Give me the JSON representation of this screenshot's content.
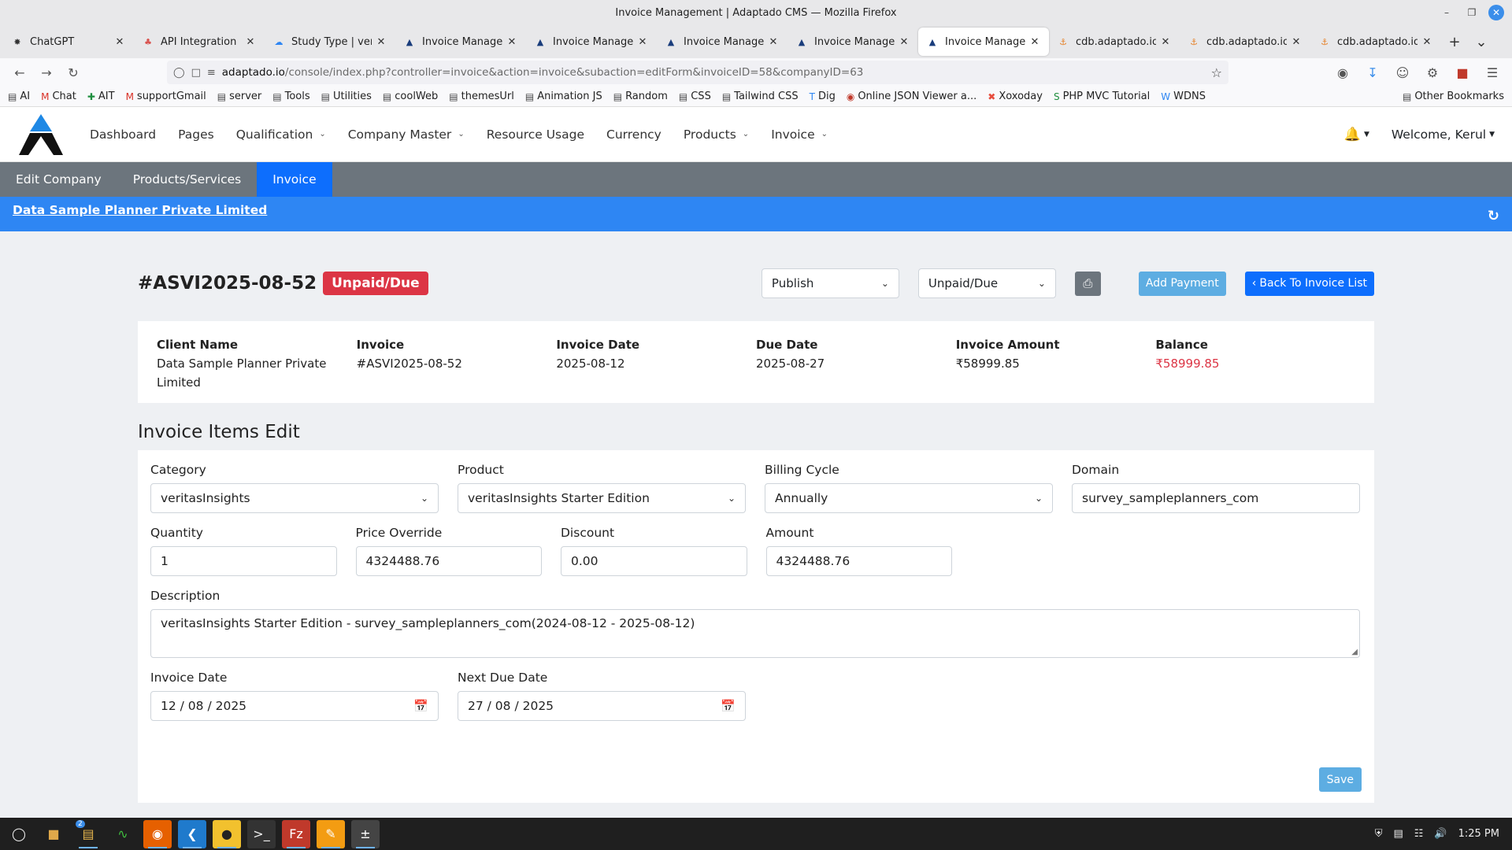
{
  "window": {
    "title": "Invoice Management | Adaptado CMS — Mozilla Firefox"
  },
  "tabs": [
    {
      "title": "ChatGPT",
      "icon": "chatgpt-icon",
      "active": false
    },
    {
      "title": "API Integration | ve",
      "icon": "api-icon",
      "active": false
    },
    {
      "title": "Study Type | verita",
      "icon": "cloud-icon",
      "active": false
    },
    {
      "title": "Invoice Manageme",
      "icon": "adaptado-icon",
      "active": false
    },
    {
      "title": "Invoice Manageme",
      "icon": "adaptado-icon",
      "active": false
    },
    {
      "title": "Invoice Manageme",
      "icon": "adaptado-icon",
      "active": false
    },
    {
      "title": "Invoice Manageme",
      "icon": "adaptado-icon",
      "active": false
    },
    {
      "title": "Invoice Manageme",
      "icon": "adaptado-icon",
      "active": true
    },
    {
      "title": "cdb.adaptado.io / ’",
      "icon": "phpmyadmin-icon",
      "active": false
    },
    {
      "title": "cdb.adaptado.io / ’",
      "icon": "phpmyadmin-icon",
      "active": false
    },
    {
      "title": "cdb.adaptado.io / ’",
      "icon": "phpmyadmin-icon",
      "active": false
    }
  ],
  "url": {
    "host": "adaptado.io",
    "rest": "/console/index.php?controller=invoice&action=invoice&subaction=editForm&invoiceID=58&companyID=63"
  },
  "bookmarks": [
    {
      "label": "AI",
      "icon": "folder-icon"
    },
    {
      "label": "Chat",
      "icon": "gmail-icon"
    },
    {
      "label": "AIT",
      "icon": "plus-icon"
    },
    {
      "label": "supportGmail",
      "icon": "gmail-icon"
    },
    {
      "label": "server",
      "icon": "folder-icon"
    },
    {
      "label": "Tools",
      "icon": "folder-icon"
    },
    {
      "label": "Utilities",
      "icon": "folder-icon"
    },
    {
      "label": "coolWeb",
      "icon": "folder-icon"
    },
    {
      "label": "themesUrl",
      "icon": "folder-icon"
    },
    {
      "label": "Animation JS",
      "icon": "folder-icon"
    },
    {
      "label": "Random",
      "icon": "folder-icon"
    },
    {
      "label": "CSS",
      "icon": "folder-icon"
    },
    {
      "label": "Tailwind CSS",
      "icon": "folder-icon"
    },
    {
      "label": "Dig",
      "icon": "t-icon"
    },
    {
      "label": "Online JSON Viewer a...",
      "icon": "circle-icon"
    },
    {
      "label": "Xoxoday",
      "icon": "x-icon"
    },
    {
      "label": "PHP MVC Tutorial",
      "icon": "s-icon"
    },
    {
      "label": "WDNS",
      "icon": "w-icon"
    }
  ],
  "bookmarks_other": "Other Bookmarks",
  "nav": {
    "items": [
      {
        "label": "Dashboard",
        "dropdown": false
      },
      {
        "label": "Pages",
        "dropdown": false
      },
      {
        "label": "Qualification",
        "dropdown": true
      },
      {
        "label": "Company Master",
        "dropdown": true
      },
      {
        "label": "Resource Usage",
        "dropdown": false
      },
      {
        "label": "Currency",
        "dropdown": false
      },
      {
        "label": "Products",
        "dropdown": true
      },
      {
        "label": "Invoice",
        "dropdown": true
      }
    ],
    "welcome": "Welcome, Kerul"
  },
  "subnav": [
    {
      "label": "Edit Company",
      "active": false
    },
    {
      "label": "Products/Services",
      "active": false
    },
    {
      "label": "Invoice",
      "active": true
    }
  ],
  "company_name": "Data Sample Planner Private Limited",
  "invoice": {
    "number": "#ASVI2025-08-52",
    "status_badge": "Unpaid/Due",
    "publish_select": "Publish",
    "status_select": "Unpaid/Due",
    "add_payment": "Add Payment",
    "back_to_list": "Back To Invoice List"
  },
  "summary": [
    {
      "header": "Client Name",
      "value": "Data Sample Planner Private Limited",
      "red": false
    },
    {
      "header": "Invoice",
      "value": "#ASVI2025-08-52",
      "red": false
    },
    {
      "header": "Invoice Date",
      "value": "2025-08-12",
      "red": false
    },
    {
      "header": "Due Date",
      "value": "2025-08-27",
      "red": false
    },
    {
      "header": "Invoice Amount",
      "value": "₹58999.85",
      "red": false
    },
    {
      "header": "Balance",
      "value": "₹58999.85",
      "red": true
    }
  ],
  "items_edit": {
    "title": "Invoice Items Edit",
    "category_label": "Category",
    "category_value": "veritasInsights",
    "product_label": "Product",
    "product_value": "veritasInsights Starter Edition",
    "billing_label": "Billing Cycle",
    "billing_value": "Annually",
    "domain_label": "Domain",
    "domain_value": "survey_sampleplanners_com",
    "quantity_label": "Quantity",
    "quantity_value": "1",
    "price_label": "Price Override",
    "price_value": "4324488.76",
    "discount_label": "Discount",
    "discount_value": "0.00",
    "amount_label": "Amount",
    "amount_value": "4324488.76",
    "description_label": "Description",
    "description_value": "veritasInsights Starter Edition - survey_sampleplanners_com(2024-08-12 - 2025-08-12)",
    "invoice_date_label": "Invoice Date",
    "invoice_date_value": "12 / 08 / 2025",
    "next_due_label": "Next Due Date",
    "next_due_value": "27 / 08 / 2025",
    "save": "Save"
  },
  "taskbar": {
    "apps": [
      "mint-menu-icon",
      "files-icon",
      "folder-icon",
      "system-monitor-icon",
      "firefox-icon",
      "vscode-icon",
      "app-icon",
      "terminal-icon",
      "filezilla-icon",
      "sublime-icon",
      "calculator-icon"
    ],
    "folder_badge": "2",
    "time": "1:25 PM"
  },
  "colors": {
    "primary": "#0d6efd",
    "company_bar": "#2e86f3",
    "danger": "#dc3545",
    "info": "#5dade2",
    "subnav": "#6c757d"
  }
}
